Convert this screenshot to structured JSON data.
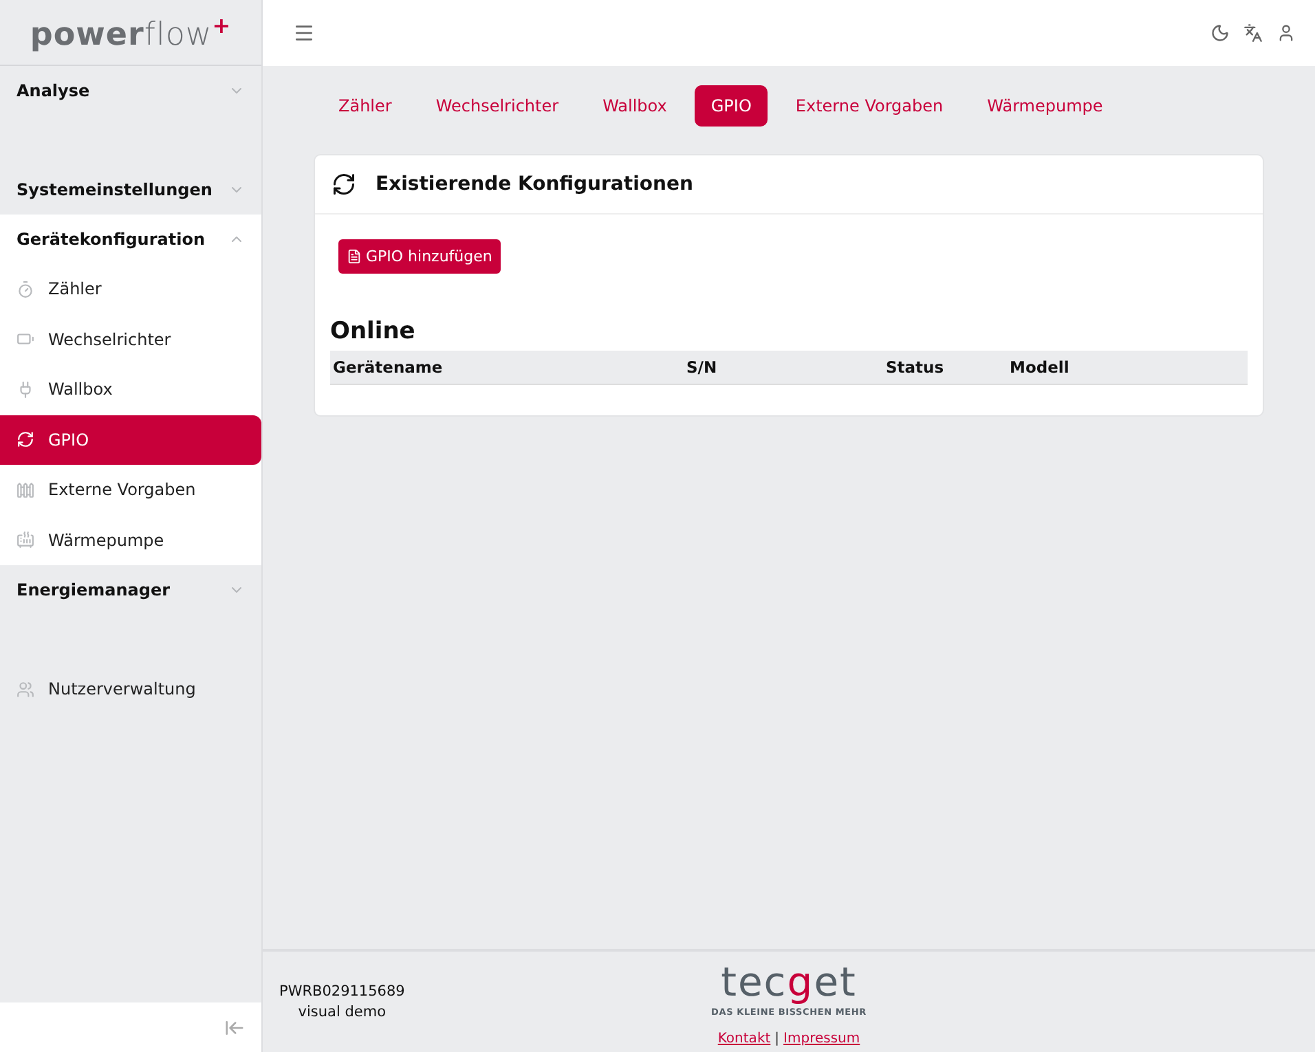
{
  "logo": {
    "bold": "power",
    "light": "flow",
    "mark": "+"
  },
  "sidebar": {
    "sections": [
      {
        "kind": "group",
        "label": "Analyse",
        "expanded": false
      },
      {
        "kind": "group",
        "label": "Systemeinstellungen",
        "expanded": false
      },
      {
        "kind": "group",
        "label": "Gerätekonfiguration",
        "expanded": true,
        "children": [
          {
            "label": "Zähler",
            "selected": false
          },
          {
            "label": "Wechselrichter",
            "selected": false
          },
          {
            "label": "Wallbox",
            "selected": false
          },
          {
            "label": "GPIO",
            "selected": true
          },
          {
            "label": "Externe Vorgaben",
            "selected": false
          },
          {
            "label": "Wärmepumpe",
            "selected": false
          }
        ]
      },
      {
        "kind": "group",
        "label": "Energiemanager",
        "expanded": false
      },
      {
        "kind": "link",
        "label": "Nutzerverwaltung"
      }
    ]
  },
  "tabs": [
    {
      "label": "Zähler",
      "selected": false
    },
    {
      "label": "Wechselrichter",
      "selected": false
    },
    {
      "label": "Wallbox",
      "selected": false
    },
    {
      "label": "GPIO",
      "selected": true
    },
    {
      "label": "Externe Vorgaben",
      "selected": false
    },
    {
      "label": "Wärmepumpe",
      "selected": false
    }
  ],
  "card": {
    "title": "Existierende Konfigurationen",
    "add_button": "GPIO hinzufügen",
    "section_title": "Online",
    "columns": [
      "Gerätename",
      "S/N",
      "Status",
      "Modell"
    ]
  },
  "footer": {
    "serial": "PWRB029115689",
    "name": "visual demo",
    "brand": {
      "start": "tec",
      "accent": "g",
      "end": "et",
      "tagline": "DAS KLEINE BISSCHEN MEHR"
    },
    "links": [
      "Kontakt",
      "Impressum"
    ],
    "separator": "|"
  }
}
